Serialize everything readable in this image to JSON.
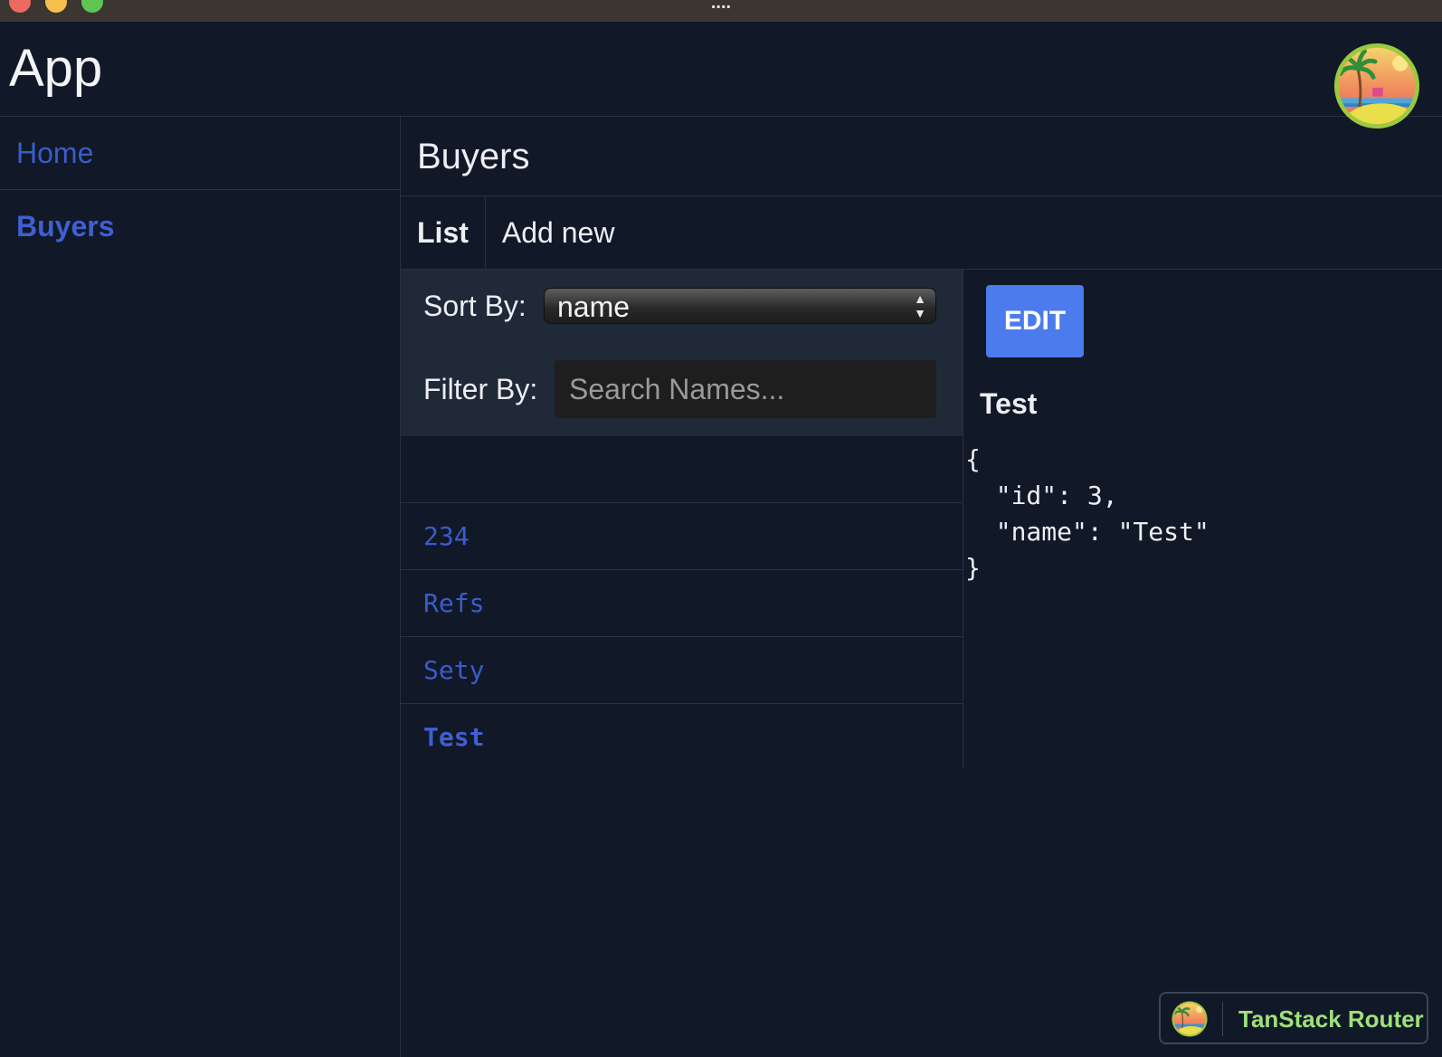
{
  "window": {
    "title": "...."
  },
  "app": {
    "title": "App"
  },
  "sidebar": {
    "items": [
      {
        "label": "Home",
        "active": false
      },
      {
        "label": "Buyers",
        "active": true
      }
    ]
  },
  "page": {
    "title": "Buyers",
    "tabs": [
      {
        "label": "List",
        "active": true
      },
      {
        "label": "Add new",
        "active": false
      }
    ]
  },
  "controls": {
    "sort_label": "Sort By:",
    "sort_value": "name",
    "filter_label": "Filter By:",
    "filter_placeholder": "Search Names...",
    "filter_value": ""
  },
  "list": {
    "items": [
      {
        "name": "234",
        "active": false
      },
      {
        "name": "Refs",
        "active": false
      },
      {
        "name": "Sety",
        "active": false
      },
      {
        "name": "Test",
        "active": true
      }
    ]
  },
  "detail": {
    "edit_label": "EDIT",
    "name": "Test",
    "json": "{\n  \"id\": 3,\n  \"name\": \"Test\"\n}"
  },
  "devtools": {
    "label": "TanStack Router"
  },
  "colors": {
    "background": "#111827",
    "panel": "#1f2937",
    "link": "#3b5ccc",
    "button": "#4b7bec",
    "devtools_text": "#9ee17a"
  },
  "icons": {
    "logo": "tropical-island-logo",
    "select": "up-down-arrows-icon"
  }
}
